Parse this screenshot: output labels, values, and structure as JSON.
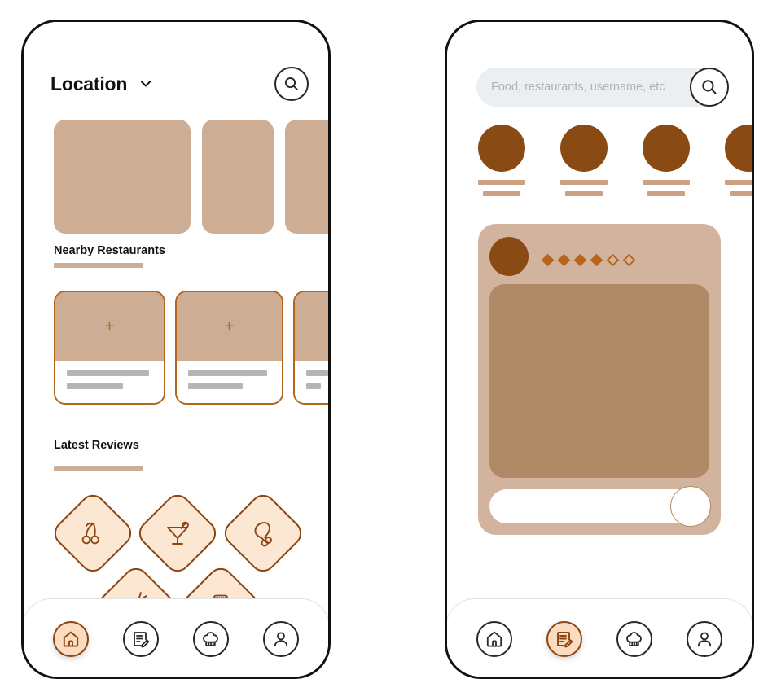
{
  "app": {
    "accent_brown": "#8a4513",
    "accent_sienna": "#b5651d",
    "tan": "#cdad94",
    "card_tan": "#d2b49e",
    "image_tan": "#b08a67",
    "peach": "#fce7d2",
    "skeleton_gray": "#b5b5b5"
  },
  "home_screen": {
    "name": "home-screen",
    "header": {
      "location_label": "Location",
      "chevron_icon": "chevron-down-icon",
      "search_icon": "search-icon"
    },
    "banners": [
      {
        "name": "banner-placeholder-1"
      },
      {
        "name": "banner-placeholder-2"
      },
      {
        "name": "banner-placeholder-3"
      }
    ],
    "nearby": {
      "title": "Nearby Restaurants",
      "cards": [
        {
          "add_icon": "plus-icon"
        },
        {
          "add_icon": "plus-icon"
        },
        {
          "add_icon": "plus-icon"
        }
      ]
    },
    "reviews": {
      "title": "Latest Reviews"
    },
    "categories": [
      {
        "label": "Cherry",
        "icon": "cherry-icon"
      },
      {
        "label": "Cocktail",
        "icon": "cocktail-icon"
      },
      {
        "label": "Chicken",
        "icon": "chicken-drumstick-icon"
      },
      {
        "label": "Carrot",
        "icon": "carrot-icon"
      },
      {
        "label": "Jar",
        "icon": "jar-icon"
      }
    ],
    "navbar": {
      "items": [
        {
          "name": "nav-home",
          "icon": "home-icon",
          "active": true
        },
        {
          "name": "nav-reviews",
          "icon": "note-edit-icon",
          "active": false
        },
        {
          "name": "nav-chef",
          "icon": "chef-hat-icon",
          "active": false
        },
        {
          "name": "nav-profile",
          "icon": "person-icon",
          "active": false
        }
      ]
    }
  },
  "feed_screen": {
    "name": "feed-screen",
    "search": {
      "placeholder": "Food, restaurants, username, etc",
      "value": "",
      "search_icon": "search-icon"
    },
    "stories": [
      {
        "name": "story-1"
      },
      {
        "name": "story-2"
      },
      {
        "name": "story-3"
      },
      {
        "name": "story-4"
      }
    ],
    "post": {
      "avatar": "user-avatar",
      "rating": {
        "filled": 4,
        "total": 6
      },
      "image": "post-image-placeholder",
      "comment_placeholder": "",
      "send_icon": "send-button"
    },
    "navbar": {
      "items": [
        {
          "name": "nav-home",
          "icon": "home-icon",
          "active": false
        },
        {
          "name": "nav-reviews",
          "icon": "note-edit-icon",
          "active": true
        },
        {
          "name": "nav-chef",
          "icon": "chef-hat-icon",
          "active": false
        },
        {
          "name": "nav-profile",
          "icon": "person-icon",
          "active": false
        }
      ]
    }
  }
}
